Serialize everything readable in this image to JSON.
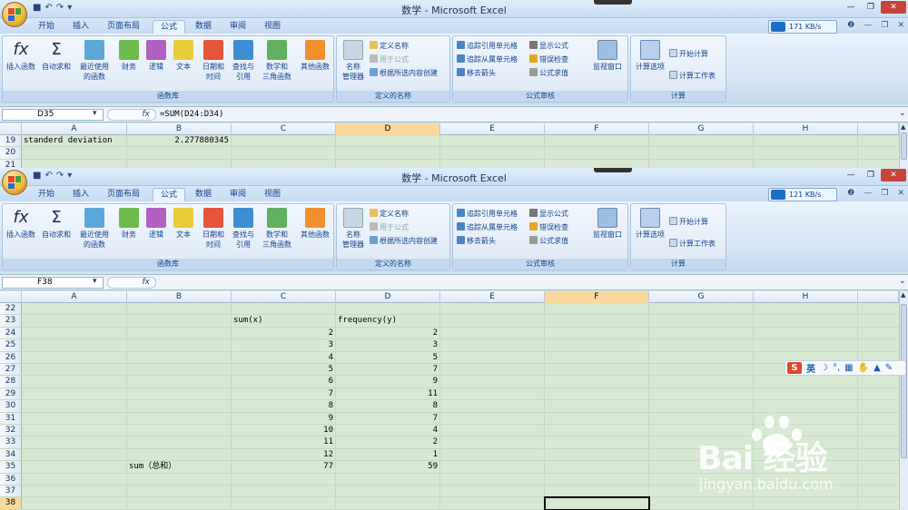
{
  "windows": [
    {
      "id": "w1",
      "title": "数学 - Microsoft Excel",
      "speed": "171 KB/s",
      "name_box": "D35",
      "fx": "fx",
      "formula": "=SUM(D24:D34)",
      "selected_col": "D",
      "rows": [
        {
          "num": "19",
          "cells": {
            "A": "standerd deviation",
            "B": "2.277880345"
          }
        },
        {
          "num": "20",
          "cells": {}
        },
        {
          "num": "21",
          "cells": {}
        }
      ]
    },
    {
      "id": "w2",
      "title": "数学 - Microsoft Excel",
      "speed": "121 KB/s",
      "name_box": "F38",
      "fx": "fx",
      "formula": "",
      "selected_col": "F",
      "selected_row": "38",
      "rows": [
        {
          "num": "22",
          "cells": {}
        },
        {
          "num": "23",
          "cells": {
            "C": "sum(x)",
            "D": "frequency(y)"
          }
        },
        {
          "num": "24",
          "cells": {
            "C": "2",
            "D": "2"
          }
        },
        {
          "num": "25",
          "cells": {
            "C": "3",
            "D": "3"
          }
        },
        {
          "num": "26",
          "cells": {
            "C": "4",
            "D": "5"
          }
        },
        {
          "num": "27",
          "cells": {
            "C": "5",
            "D": "7"
          }
        },
        {
          "num": "28",
          "cells": {
            "C": "6",
            "D": "9"
          }
        },
        {
          "num": "29",
          "cells": {
            "C": "7",
            "D": "11"
          }
        },
        {
          "num": "30",
          "cells": {
            "C": "8",
            "D": "8"
          }
        },
        {
          "num": "31",
          "cells": {
            "C": "9",
            "D": "7"
          }
        },
        {
          "num": "32",
          "cells": {
            "C": "10",
            "D": "4"
          }
        },
        {
          "num": "33",
          "cells": {
            "C": "11",
            "D": "2"
          }
        },
        {
          "num": "34",
          "cells": {
            "C": "12",
            "D": "1"
          }
        },
        {
          "num": "35",
          "cells": {
            "B": "sum（总和）",
            "C": "77",
            "D": "59"
          }
        },
        {
          "num": "36",
          "cells": {}
        },
        {
          "num": "37",
          "cells": {}
        },
        {
          "num": "38",
          "cells": {}
        }
      ]
    }
  ],
  "tabs": [
    "开始",
    "插入",
    "页面布局",
    "公式",
    "数据",
    "审阅",
    "视图"
  ],
  "active_tab": "公式",
  "columns": [
    "A",
    "B",
    "C",
    "D",
    "E",
    "F",
    "G",
    "H"
  ],
  "ribbon": {
    "insert_function": "插入函数",
    "autosum": "自动求和",
    "recent_line1": "最近使用",
    "recent_line2": "的函数",
    "financial": "财务",
    "logical": "逻辑",
    "text": "文本",
    "datetime_line1": "日期和",
    "datetime_line2": "时间",
    "lookup_line1": "查找与",
    "lookup_line2": "引用",
    "math_line1": "数学和",
    "math_line2": "三角函数",
    "more": "其他函数",
    "library_label": "函数库",
    "name_manager_line1": "名称",
    "name_manager_line2": "管理器",
    "define_name": "定义名称",
    "use_in_formula": "用于公式",
    "create_from_selection": "根据所选内容创建",
    "defined_names_label": "定义的名称",
    "trace_precedents": "追踪引用单元格",
    "trace_dependents": "追踪从属单元格",
    "remove_arrows": "移去箭头",
    "show_formulas": "显示公式",
    "error_checking": "错误检查",
    "evaluate_formula": "公式求值",
    "watch_window": "监视窗口",
    "auditing_label": "公式审核",
    "calc_options": "计算选项",
    "calc_now": "开始计算",
    "calc_sheet": "计算工作表",
    "calculation_label": "计算"
  },
  "ime": {
    "label": "英"
  },
  "watermark": {
    "brand": "Bai   经验",
    "url": "jingyan.baidu.com"
  },
  "colors": {
    "sheet_bg": "#d7e8d3",
    "selected_header": "#f9d99e",
    "ribbon_text": "#15428b"
  }
}
